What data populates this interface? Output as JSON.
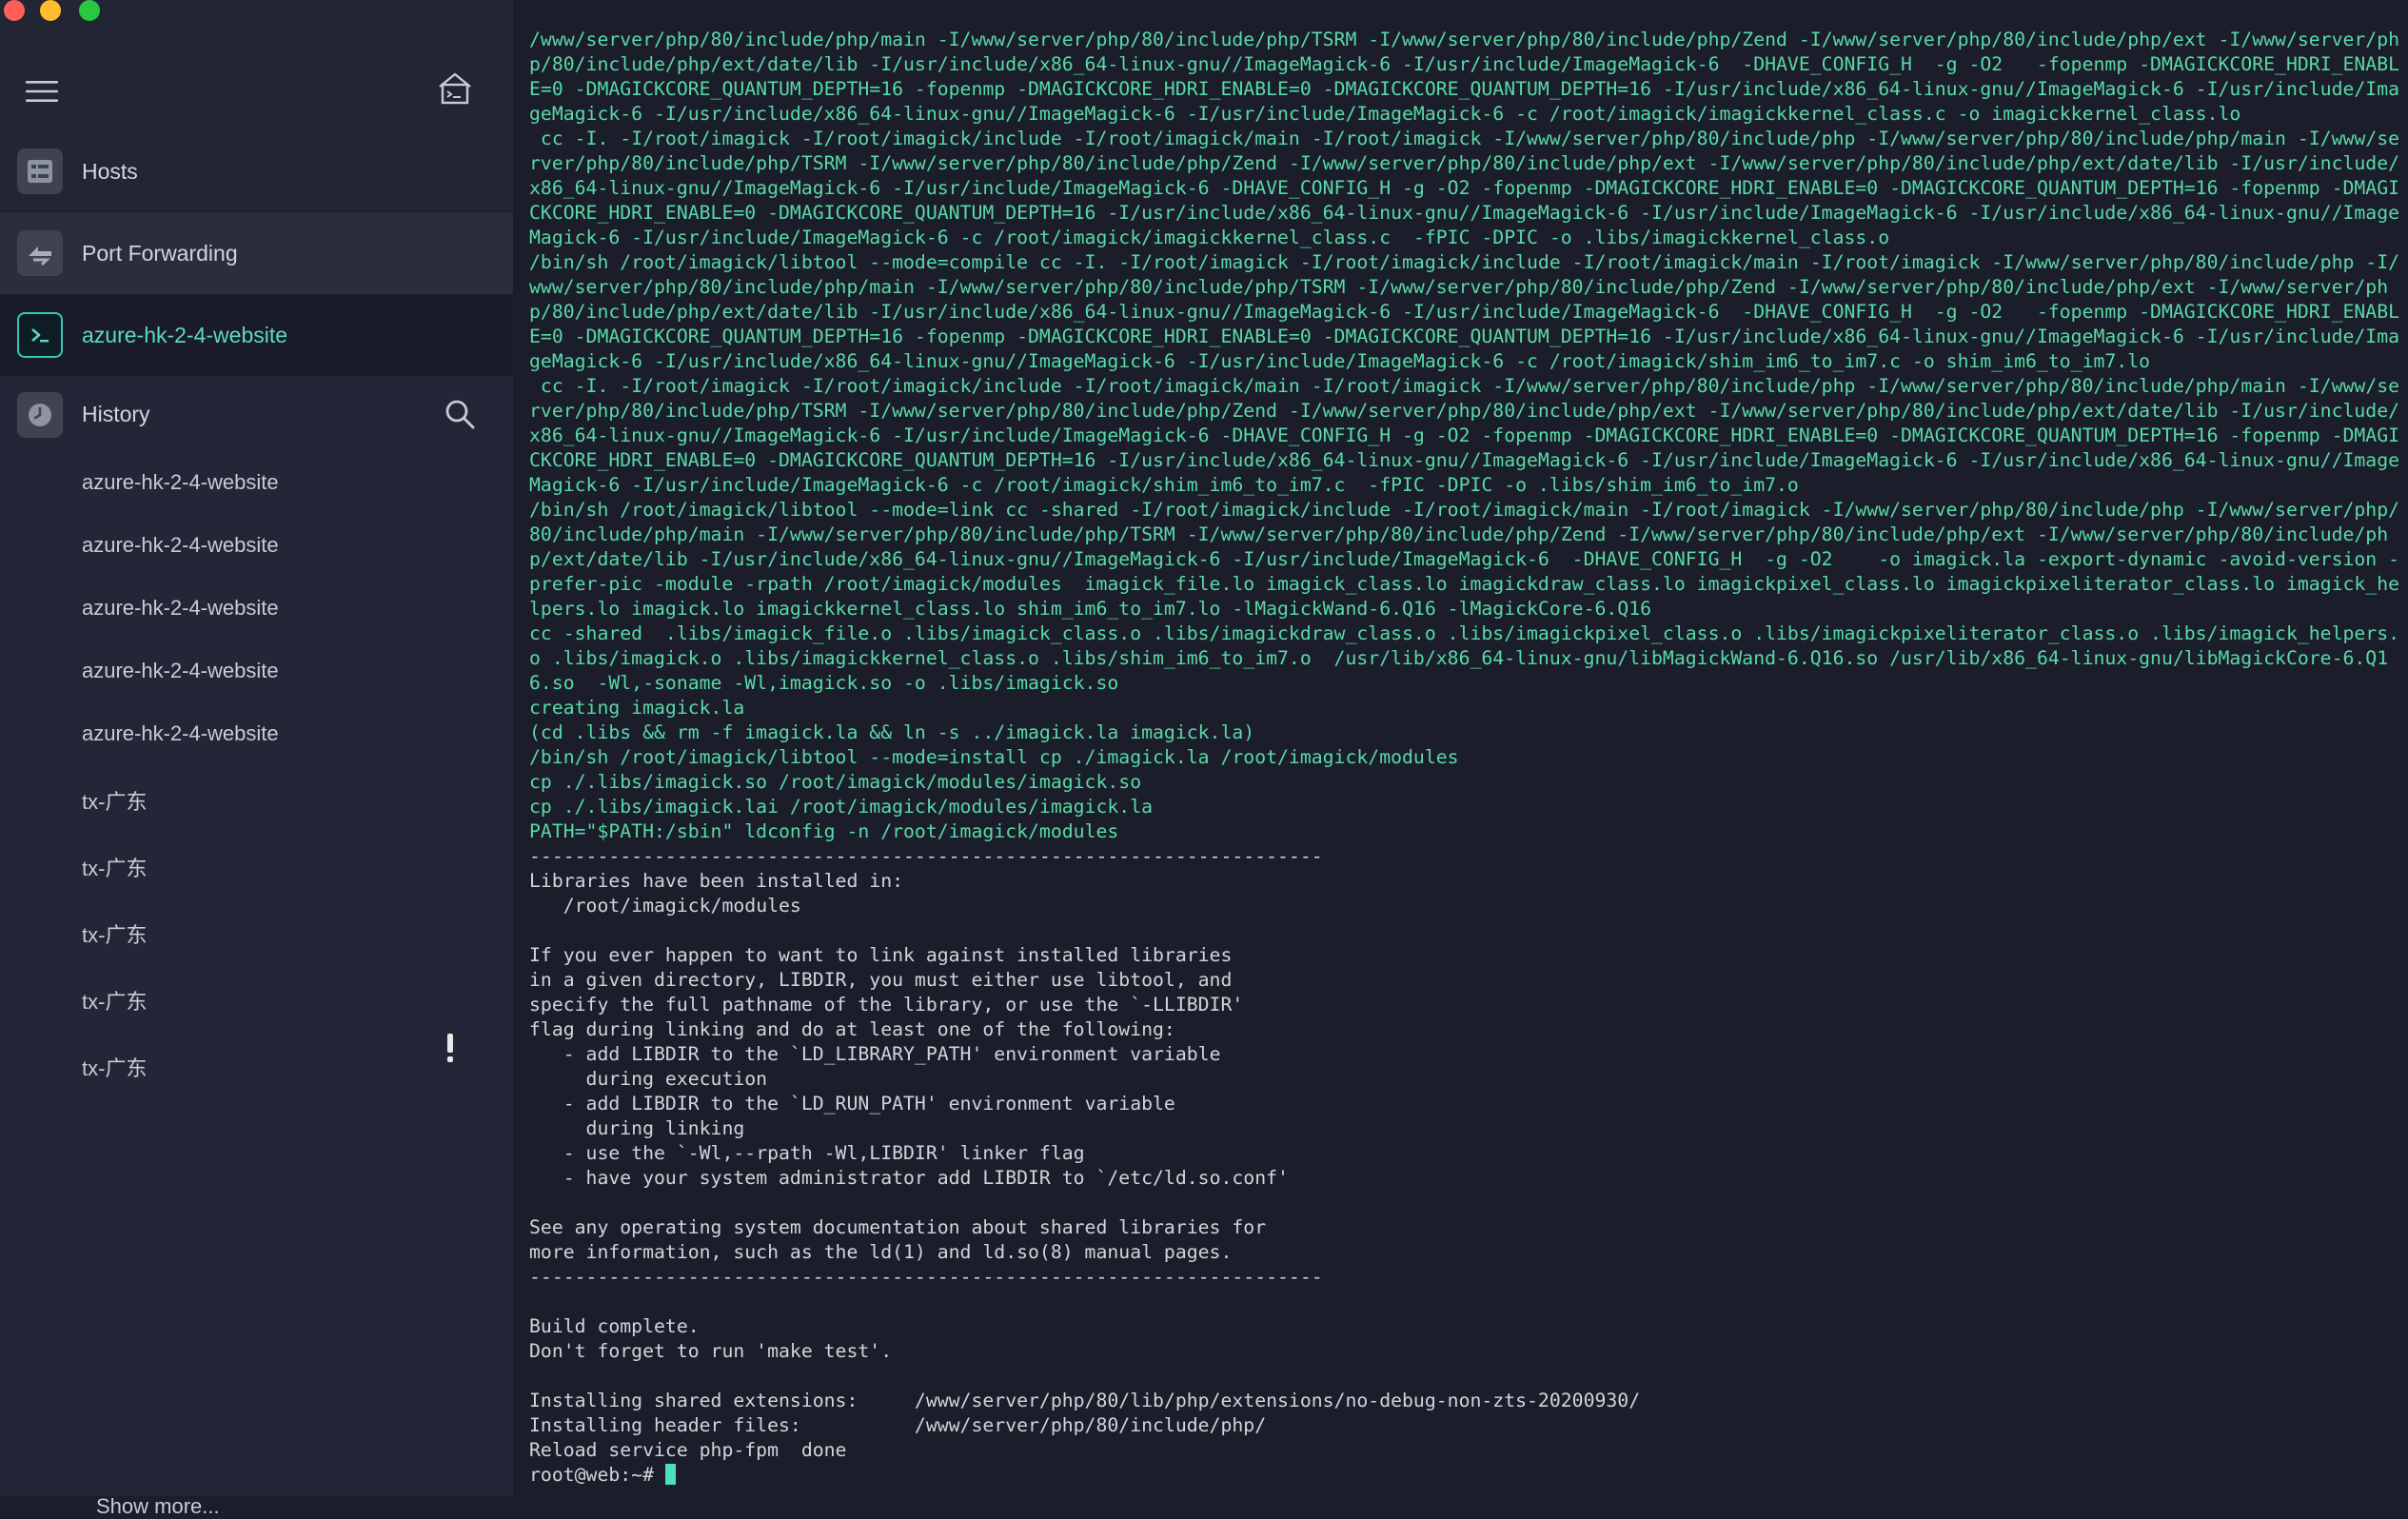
{
  "window": {
    "controls": [
      "close",
      "minimize",
      "zoom"
    ]
  },
  "sidebar": {
    "icons": {
      "menu": "menu-icon",
      "home": "home-terminal-icon"
    },
    "nav": [
      {
        "label": "Hosts",
        "icon": "hosts-icon"
      },
      {
        "label": "Port Forwarding",
        "icon": "port-forwarding-icon"
      },
      {
        "label": "azure-hk-2-4-website",
        "icon": "terminal-icon",
        "active": true
      }
    ],
    "history": {
      "label": "History",
      "icon": "history-clock-icon",
      "search_icon": "search-icon",
      "items": [
        "azure-hk-2-4-website",
        "azure-hk-2-4-website",
        "azure-hk-2-4-website",
        "azure-hk-2-4-website",
        "azure-hk-2-4-website",
        "tx-广东",
        "tx-广东",
        "tx-广东",
        "tx-广东",
        "tx-广东"
      ],
      "warning_on_item": 4,
      "show_more": "Show more..."
    }
  },
  "terminal": {
    "build_log": "/www/server/php/80/include/php/main -I/www/server/php/80/include/php/TSRM -I/www/server/php/80/include/php/Zend -I/www/server/php/80/include/php/ext -I/www/server/php/80/include/php/ext/date/lib -I/usr/include/x86_64-linux-gnu//ImageMagick-6 -I/usr/include/ImageMagick-6  -DHAVE_CONFIG_H  -g -O2   -fopenmp -DMAGICKCORE_HDRI_ENABLE=0 -DMAGICKCORE_QUANTUM_DEPTH=16 -fopenmp -DMAGICKCORE_HDRI_ENABLE=0 -DMAGICKCORE_QUANTUM_DEPTH=16 -I/usr/include/x86_64-linux-gnu//ImageMagick-6 -I/usr/include/ImageMagick-6 -I/usr/include/x86_64-linux-gnu//ImageMagick-6 -I/usr/include/ImageMagick-6 -c /root/imagick/imagickkernel_class.c -o imagickkernel_class.lo\n cc -I. -I/root/imagick -I/root/imagick/include -I/root/imagick/main -I/root/imagick -I/www/server/php/80/include/php -I/www/server/php/80/include/php/main -I/www/server/php/80/include/php/TSRM -I/www/server/php/80/include/php/Zend -I/www/server/php/80/include/php/ext -I/www/server/php/80/include/php/ext/date/lib -I/usr/include/x86_64-linux-gnu//ImageMagick-6 -I/usr/include/ImageMagick-6 -DHAVE_CONFIG_H -g -O2 -fopenmp -DMAGICKCORE_HDRI_ENABLE=0 -DMAGICKCORE_QUANTUM_DEPTH=16 -fopenmp -DMAGICKCORE_HDRI_ENABLE=0 -DMAGICKCORE_QUANTUM_DEPTH=16 -I/usr/include/x86_64-linux-gnu//ImageMagick-6 -I/usr/include/ImageMagick-6 -I/usr/include/x86_64-linux-gnu//ImageMagick-6 -I/usr/include/ImageMagick-6 -c /root/imagick/imagickkernel_class.c  -fPIC -DPIC -o .libs/imagickkernel_class.o\n/bin/sh /root/imagick/libtool --mode=compile cc -I. -I/root/imagick -I/root/imagick/include -I/root/imagick/main -I/root/imagick -I/www/server/php/80/include/php -I/www/server/php/80/include/php/main -I/www/server/php/80/include/php/TSRM -I/www/server/php/80/include/php/Zend -I/www/server/php/80/include/php/ext -I/www/server/php/80/include/php/ext/date/lib -I/usr/include/x86_64-linux-gnu//ImageMagick-6 -I/usr/include/ImageMagick-6  -DHAVE_CONFIG_H  -g -O2   -fopenmp -DMAGICKCORE_HDRI_ENABLE=0 -DMAGICKCORE_QUANTUM_DEPTH=16 -fopenmp -DMAGICKCORE_HDRI_ENABLE=0 -DMAGICKCORE_QUANTUM_DEPTH=16 -I/usr/include/x86_64-linux-gnu//ImageMagick-6 -I/usr/include/ImageMagick-6 -I/usr/include/x86_64-linux-gnu//ImageMagick-6 -I/usr/include/ImageMagick-6 -c /root/imagick/shim_im6_to_im7.c -o shim_im6_to_im7.lo\n cc -I. -I/root/imagick -I/root/imagick/include -I/root/imagick/main -I/root/imagick -I/www/server/php/80/include/php -I/www/server/php/80/include/php/main -I/www/server/php/80/include/php/TSRM -I/www/server/php/80/include/php/Zend -I/www/server/php/80/include/php/ext -I/www/server/php/80/include/php/ext/date/lib -I/usr/include/x86_64-linux-gnu//ImageMagick-6 -I/usr/include/ImageMagick-6 -DHAVE_CONFIG_H -g -O2 -fopenmp -DMAGICKCORE_HDRI_ENABLE=0 -DMAGICKCORE_QUANTUM_DEPTH=16 -fopenmp -DMAGICKCORE_HDRI_ENABLE=0 -DMAGICKCORE_QUANTUM_DEPTH=16 -I/usr/include/x86_64-linux-gnu//ImageMagick-6 -I/usr/include/ImageMagick-6 -I/usr/include/x86_64-linux-gnu//ImageMagick-6 -I/usr/include/ImageMagick-6 -c /root/imagick/shim_im6_to_im7.c  -fPIC -DPIC -o .libs/shim_im6_to_im7.o\n/bin/sh /root/imagick/libtool --mode=link cc -shared -I/root/imagick/include -I/root/imagick/main -I/root/imagick -I/www/server/php/80/include/php -I/www/server/php/80/include/php/main -I/www/server/php/80/include/php/TSRM -I/www/server/php/80/include/php/Zend -I/www/server/php/80/include/php/ext -I/www/server/php/80/include/php/ext/date/lib -I/usr/include/x86_64-linux-gnu//ImageMagick-6 -I/usr/include/ImageMagick-6  -DHAVE_CONFIG_H  -g -O2    -o imagick.la -export-dynamic -avoid-version -prefer-pic -module -rpath /root/imagick/modules  imagick_file.lo imagick_class.lo imagickdraw_class.lo imagickpixel_class.lo imagickpixeliterator_class.lo imagick_helpers.lo imagick.lo imagickkernel_class.lo shim_im6_to_im7.lo -lMagickWand-6.Q16 -lMagickCore-6.Q16\ncc -shared  .libs/imagick_file.o .libs/imagick_class.o .libs/imagickdraw_class.o .libs/imagickpixel_class.o .libs/imagickpixeliterator_class.o .libs/imagick_helpers.o .libs/imagick.o .libs/imagickkernel_class.o .libs/shim_im6_to_im7.o  /usr/lib/x86_64-linux-gnu/libMagickWand-6.Q16.so /usr/lib/x86_64-linux-gnu/libMagickCore-6.Q16.so  -Wl,-soname -Wl,imagick.so -o .libs/imagick.so\ncreating imagick.la\n(cd .libs && rm -f imagick.la && ln -s ../imagick.la imagick.la)\n/bin/sh /root/imagick/libtool --mode=install cp ./imagick.la /root/imagick/modules\ncp ./.libs/imagick.so /root/imagick/modules/imagick.so\ncp ./.libs/imagick.lai /root/imagick/modules/imagick.la\nPATH=\"$PATH:/sbin\" ldconfig -n /root/imagick/modules",
    "install_message": "----------------------------------------------------------------------\nLibraries have been installed in:\n   /root/imagick/modules\n\nIf you ever happen to want to link against installed libraries\nin a given directory, LIBDIR, you must either use libtool, and\nspecify the full pathname of the library, or use the `-LLIBDIR'\nflag during linking and do at least one of the following:\n   - add LIBDIR to the `LD_LIBRARY_PATH' environment variable\n     during execution\n   - add LIBDIR to the `LD_RUN_PATH' environment variable\n     during linking\n   - use the `-Wl,--rpath -Wl,LIBDIR' linker flag\n   - have your system administrator add LIBDIR to `/etc/ld.so.conf'\n\nSee any operating system documentation about shared libraries for\nmore information, such as the ld(1) and ld.so(8) manual pages.\n----------------------------------------------------------------------\n\nBuild complete.\nDon't forget to run 'make test'.\n\nInstalling shared extensions:     /www/server/php/80/lib/php/extensions/no-debug-non-zts-20200930/\nInstalling header files:          /www/server/php/80/include/php/\nReload service php-fpm  done",
    "prompt": "root@web:~# "
  },
  "colors": {
    "sidebar_bg": "#222534",
    "terminal_bg": "#1b1d2b",
    "command_text": "#58d9a6",
    "accent": "#33c7b4",
    "warning": "#e8e8e8"
  }
}
